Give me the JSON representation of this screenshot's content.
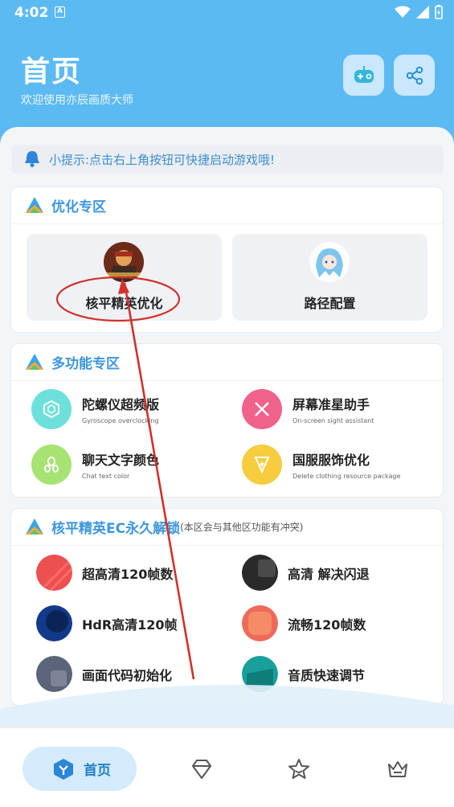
{
  "status_bar": {
    "time": "4:02",
    "notif_letter": "A"
  },
  "header": {
    "title": "首页",
    "subtitle": "欢迎使用亦辰画质大师",
    "icons": [
      "gamepad-add-icon",
      "share-icon"
    ]
  },
  "tip": {
    "icon": "bell-icon",
    "text": "小提示:点击右上角按钮可快捷启动游戏哦!"
  },
  "optimize": {
    "title": "优化专区",
    "tiles": [
      {
        "label": "核平精英优化",
        "image": "game-character-avatar"
      },
      {
        "label": "路径配置",
        "image": "anime-girl-avatar"
      }
    ]
  },
  "multi": {
    "title": "多功能专区",
    "features": [
      {
        "name": "陀螺仪超频版",
        "sub": "Gyroscope overclocking",
        "icon": "hexagon-icon",
        "color": "#6ee0dc"
      },
      {
        "name": "屏幕准星助手",
        "sub": "On-screen sight assistant",
        "icon": "cross-icon",
        "color": "#f0628c"
      },
      {
        "name": "聊天文字颜色",
        "sub": "Chat text color",
        "icon": "seed-icon",
        "color": "#a7e373"
      },
      {
        "name": "国服服饰优化",
        "sub": "Delete clothing resource package",
        "icon": "lightning-icon",
        "color": "#f7cc3d"
      }
    ]
  },
  "unlock": {
    "title": "核平精英EC永久解锁",
    "note": "(本区会与其他区功能有冲突)",
    "items": [
      {
        "name": "超高清120帧数",
        "color": "#ee4f4f"
      },
      {
        "name": "高清 解决闪退",
        "color": "#2a2a2a"
      },
      {
        "name": "HdR高清120帧",
        "color": "#133a8a"
      },
      {
        "name": "流畅120帧数",
        "color": "#ee6a5a"
      },
      {
        "name": "画面代码初始化",
        "color": "#5b6478"
      },
      {
        "name": "音质快速调节",
        "color": "#199f9c"
      }
    ]
  },
  "nav": {
    "active_label": "首页",
    "items": [
      "home-cube-icon",
      "diamond-icon",
      "star-icon",
      "crown-icon"
    ]
  },
  "colors": {
    "header": "#5cbaf2",
    "accent": "#3d96dc",
    "annotation": "#d0312d"
  }
}
